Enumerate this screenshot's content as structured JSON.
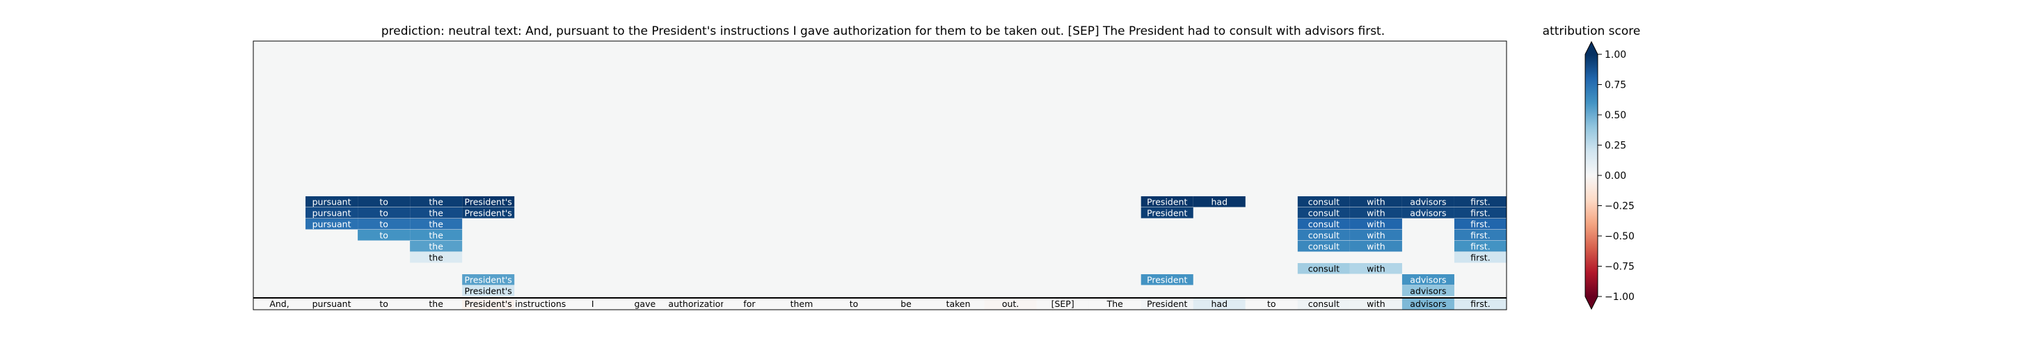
{
  "chart_data": {
    "type": "heatmap",
    "title": "prediction:  neutral     text:  And, pursuant to the President's instructions I gave authorization for them to be taken out. [SEP] The President had to consult with advisors first.",
    "tokens": [
      "And,",
      "pursuant",
      "to",
      "the",
      "President's",
      "instructions",
      "I",
      "gave",
      "authorization",
      "for",
      "them",
      "to",
      "be",
      "taken",
      "out.",
      "[SEP]",
      "The",
      "President",
      "had",
      "to",
      "consult",
      "with",
      "advisors",
      "first."
    ],
    "token_attribution": [
      0.0,
      0.0,
      0.0,
      0.0,
      -0.05,
      0.0,
      0.0,
      0.0,
      0.0,
      0.0,
      0.0,
      0.0,
      0.0,
      0.0,
      -0.02,
      0.0,
      0.0,
      0.03,
      0.12,
      0.0,
      0.05,
      0.05,
      0.45,
      0.15
    ],
    "layers": [
      {
        "level": 1,
        "cells": [
          {
            "index": 4,
            "value": 0.2
          },
          {
            "index": 22,
            "value": 0.4
          }
        ]
      },
      {
        "level": 2,
        "cells": [
          {
            "index": 4,
            "value": 0.55
          },
          {
            "index": 17,
            "value": 0.6
          },
          {
            "index": 22,
            "value": 0.6
          }
        ]
      },
      {
        "level": 3,
        "cells": [
          {
            "index": 20,
            "value": 0.35
          },
          {
            "index": 21,
            "value": 0.3
          }
        ]
      },
      {
        "level": 4,
        "cells": [
          {
            "index": 3,
            "value": 0.15
          },
          {
            "index": 23,
            "value": 0.2
          }
        ]
      },
      {
        "level": 5,
        "cells": [
          {
            "index": 3,
            "value": 0.55
          },
          {
            "index": 20,
            "value": 0.65
          },
          {
            "index": 21,
            "value": 0.65
          },
          {
            "index": 23,
            "value": 0.6
          }
        ]
      },
      {
        "level": 6,
        "cells": [
          {
            "index": 2,
            "value": 0.6
          },
          {
            "index": 3,
            "value": 0.6
          },
          {
            "index": 20,
            "value": 0.7
          },
          {
            "index": 21,
            "value": 0.7
          },
          {
            "index": 23,
            "value": 0.7
          }
        ]
      },
      {
        "level": 7,
        "cells": [
          {
            "index": 1,
            "value": 0.75
          },
          {
            "index": 2,
            "value": 0.75
          },
          {
            "index": 3,
            "value": 0.75
          },
          {
            "index": 20,
            "value": 0.8
          },
          {
            "index": 21,
            "value": 0.8
          },
          {
            "index": 23,
            "value": 0.8
          }
        ]
      },
      {
        "level": 8,
        "cells": [
          {
            "index": 1,
            "value": 0.9
          },
          {
            "index": 2,
            "value": 0.9
          },
          {
            "index": 3,
            "value": 0.9
          },
          {
            "index": 4,
            "value": 0.95
          },
          {
            "index": 17,
            "value": 0.95
          },
          {
            "index": 20,
            "value": 0.92
          },
          {
            "index": 21,
            "value": 0.92
          },
          {
            "index": 22,
            "value": 0.92
          },
          {
            "index": 23,
            "value": 0.92
          }
        ]
      },
      {
        "level": 9,
        "cells": [
          {
            "index": 1,
            "value": 0.95
          },
          {
            "index": 2,
            "value": 0.95
          },
          {
            "index": 3,
            "value": 0.95
          },
          {
            "index": 4,
            "value": 0.98
          },
          {
            "index": 17,
            "value": 0.98
          },
          {
            "index": 18,
            "value": 0.98
          },
          {
            "index": 20,
            "value": 0.95
          },
          {
            "index": 21,
            "value": 0.95
          },
          {
            "index": 22,
            "value": 0.95
          },
          {
            "index": 23,
            "value": 0.95
          }
        ]
      }
    ],
    "colorbar": {
      "label": "attribution score",
      "ticks": [
        1.0,
        0.75,
        0.5,
        0.25,
        0.0,
        -0.25,
        -0.5,
        -0.75,
        -1.0
      ],
      "tick_labels": [
        "1.00",
        "0.75",
        "0.50",
        "0.25",
        "0.00",
        "−0.25",
        "−0.50",
        "−0.75",
        "−1.00"
      ],
      "range": [
        -1,
        1
      ],
      "colormap": "RdBu",
      "extend": "both"
    },
    "grid": false
  }
}
